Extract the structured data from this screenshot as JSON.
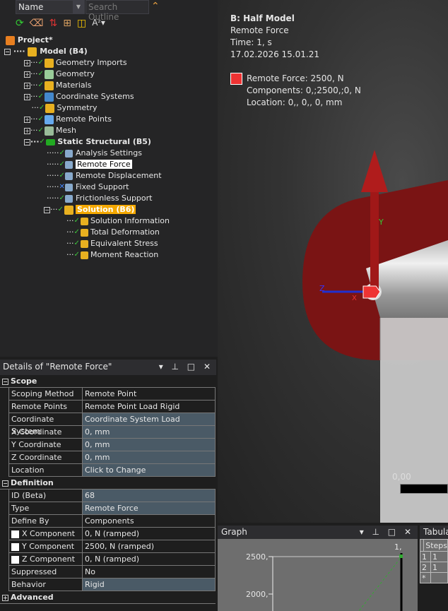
{
  "toolbar": {
    "name_label": "Name",
    "search_placeholder": "Search Outline"
  },
  "tree": {
    "project": "Project*",
    "model": "Model (B4)",
    "items": [
      "Geometry Imports",
      "Geometry",
      "Materials",
      "Coordinate Systems",
      "Symmetry",
      "Remote Points",
      "Mesh"
    ],
    "static": "Static Structural (B5)",
    "static_items": [
      "Analysis Settings",
      "Remote Force",
      "Remote Displacement",
      "Fixed Support",
      "Frictionless Support"
    ],
    "solution": "Solution (B6)",
    "solution_items": [
      "Solution Information",
      "Total Deformation",
      "Equivalent Stress",
      "Moment Reaction"
    ]
  },
  "details": {
    "title": "Details of \"Remote Force\"",
    "scope": "Scope",
    "definition": "Definition",
    "advanced": "Advanced",
    "scope_rows": [
      [
        "Scoping Method",
        "Remote Point"
      ],
      [
        "Remote Points",
        "Remote Point Load Rigid"
      ],
      [
        "Coordinate System",
        "Coordinate System Load"
      ],
      [
        "X Coordinate",
        "0, mm"
      ],
      [
        "Y Coordinate",
        "0, mm"
      ],
      [
        "Z Coordinate",
        "0, mm"
      ],
      [
        "Location",
        "Click to Change"
      ]
    ],
    "def_rows": [
      [
        "ID (Beta)",
        "68"
      ],
      [
        "Type",
        "Remote Force"
      ],
      [
        "Define By",
        "Components"
      ],
      [
        "X Component",
        "0, N  (ramped)"
      ],
      [
        "Y Component",
        "2500, N  (ramped)"
      ],
      [
        "Z Component",
        "0, N  (ramped)"
      ],
      [
        "Suppressed",
        "No"
      ],
      [
        "Behavior",
        "Rigid"
      ]
    ]
  },
  "viewport": {
    "title": "B: Half Model",
    "subtitle": "Remote Force",
    "time": "Time: 1, s",
    "date": "17.02.2026 15.01.21",
    "legend": "Remote Force: 2500, N",
    "components": "Components: 0,;2500,;0, N",
    "location": "Location: 0,, 0,, 0, mm",
    "scale": "0,00",
    "axis_y": "Y",
    "axis_z": "Z",
    "axis_x": "X"
  },
  "graph": {
    "title": "Graph",
    "y1": "2500,",
    "y2": "2000,",
    "x1": "1,"
  },
  "tabular": {
    "title": "Tabular Data",
    "col": "Steps",
    "rows": [
      "1",
      "1"
    ],
    "row_ids": [
      "1",
      "2",
      "*"
    ]
  }
}
